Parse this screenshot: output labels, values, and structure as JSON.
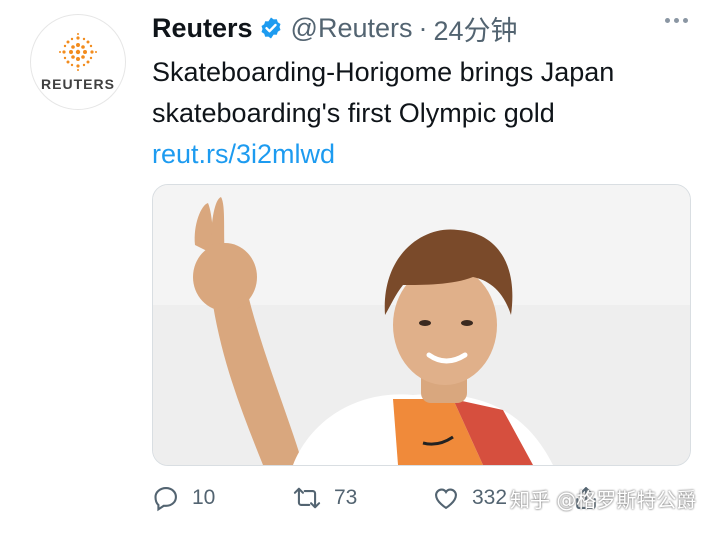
{
  "author": {
    "name": "Reuters",
    "handle": "@Reuters",
    "separator": "·",
    "timestamp": "24分钟",
    "avatar_brand": "REUTERS",
    "verified_icon": "verified-badge-icon"
  },
  "tweet": {
    "text": "Skateboarding-Horigome brings Japan skateboarding's first Olympic gold",
    "link": "reut.rs/3i2mlwd"
  },
  "actions": {
    "reply_count": "10",
    "retweet_count": "73",
    "like_count": "332"
  },
  "watermark": "知乎 @格罗斯特公爵",
  "colors": {
    "accent": "#1d9bf0",
    "secondary_text": "#536471",
    "reuters_orange": "#f28c1e"
  }
}
